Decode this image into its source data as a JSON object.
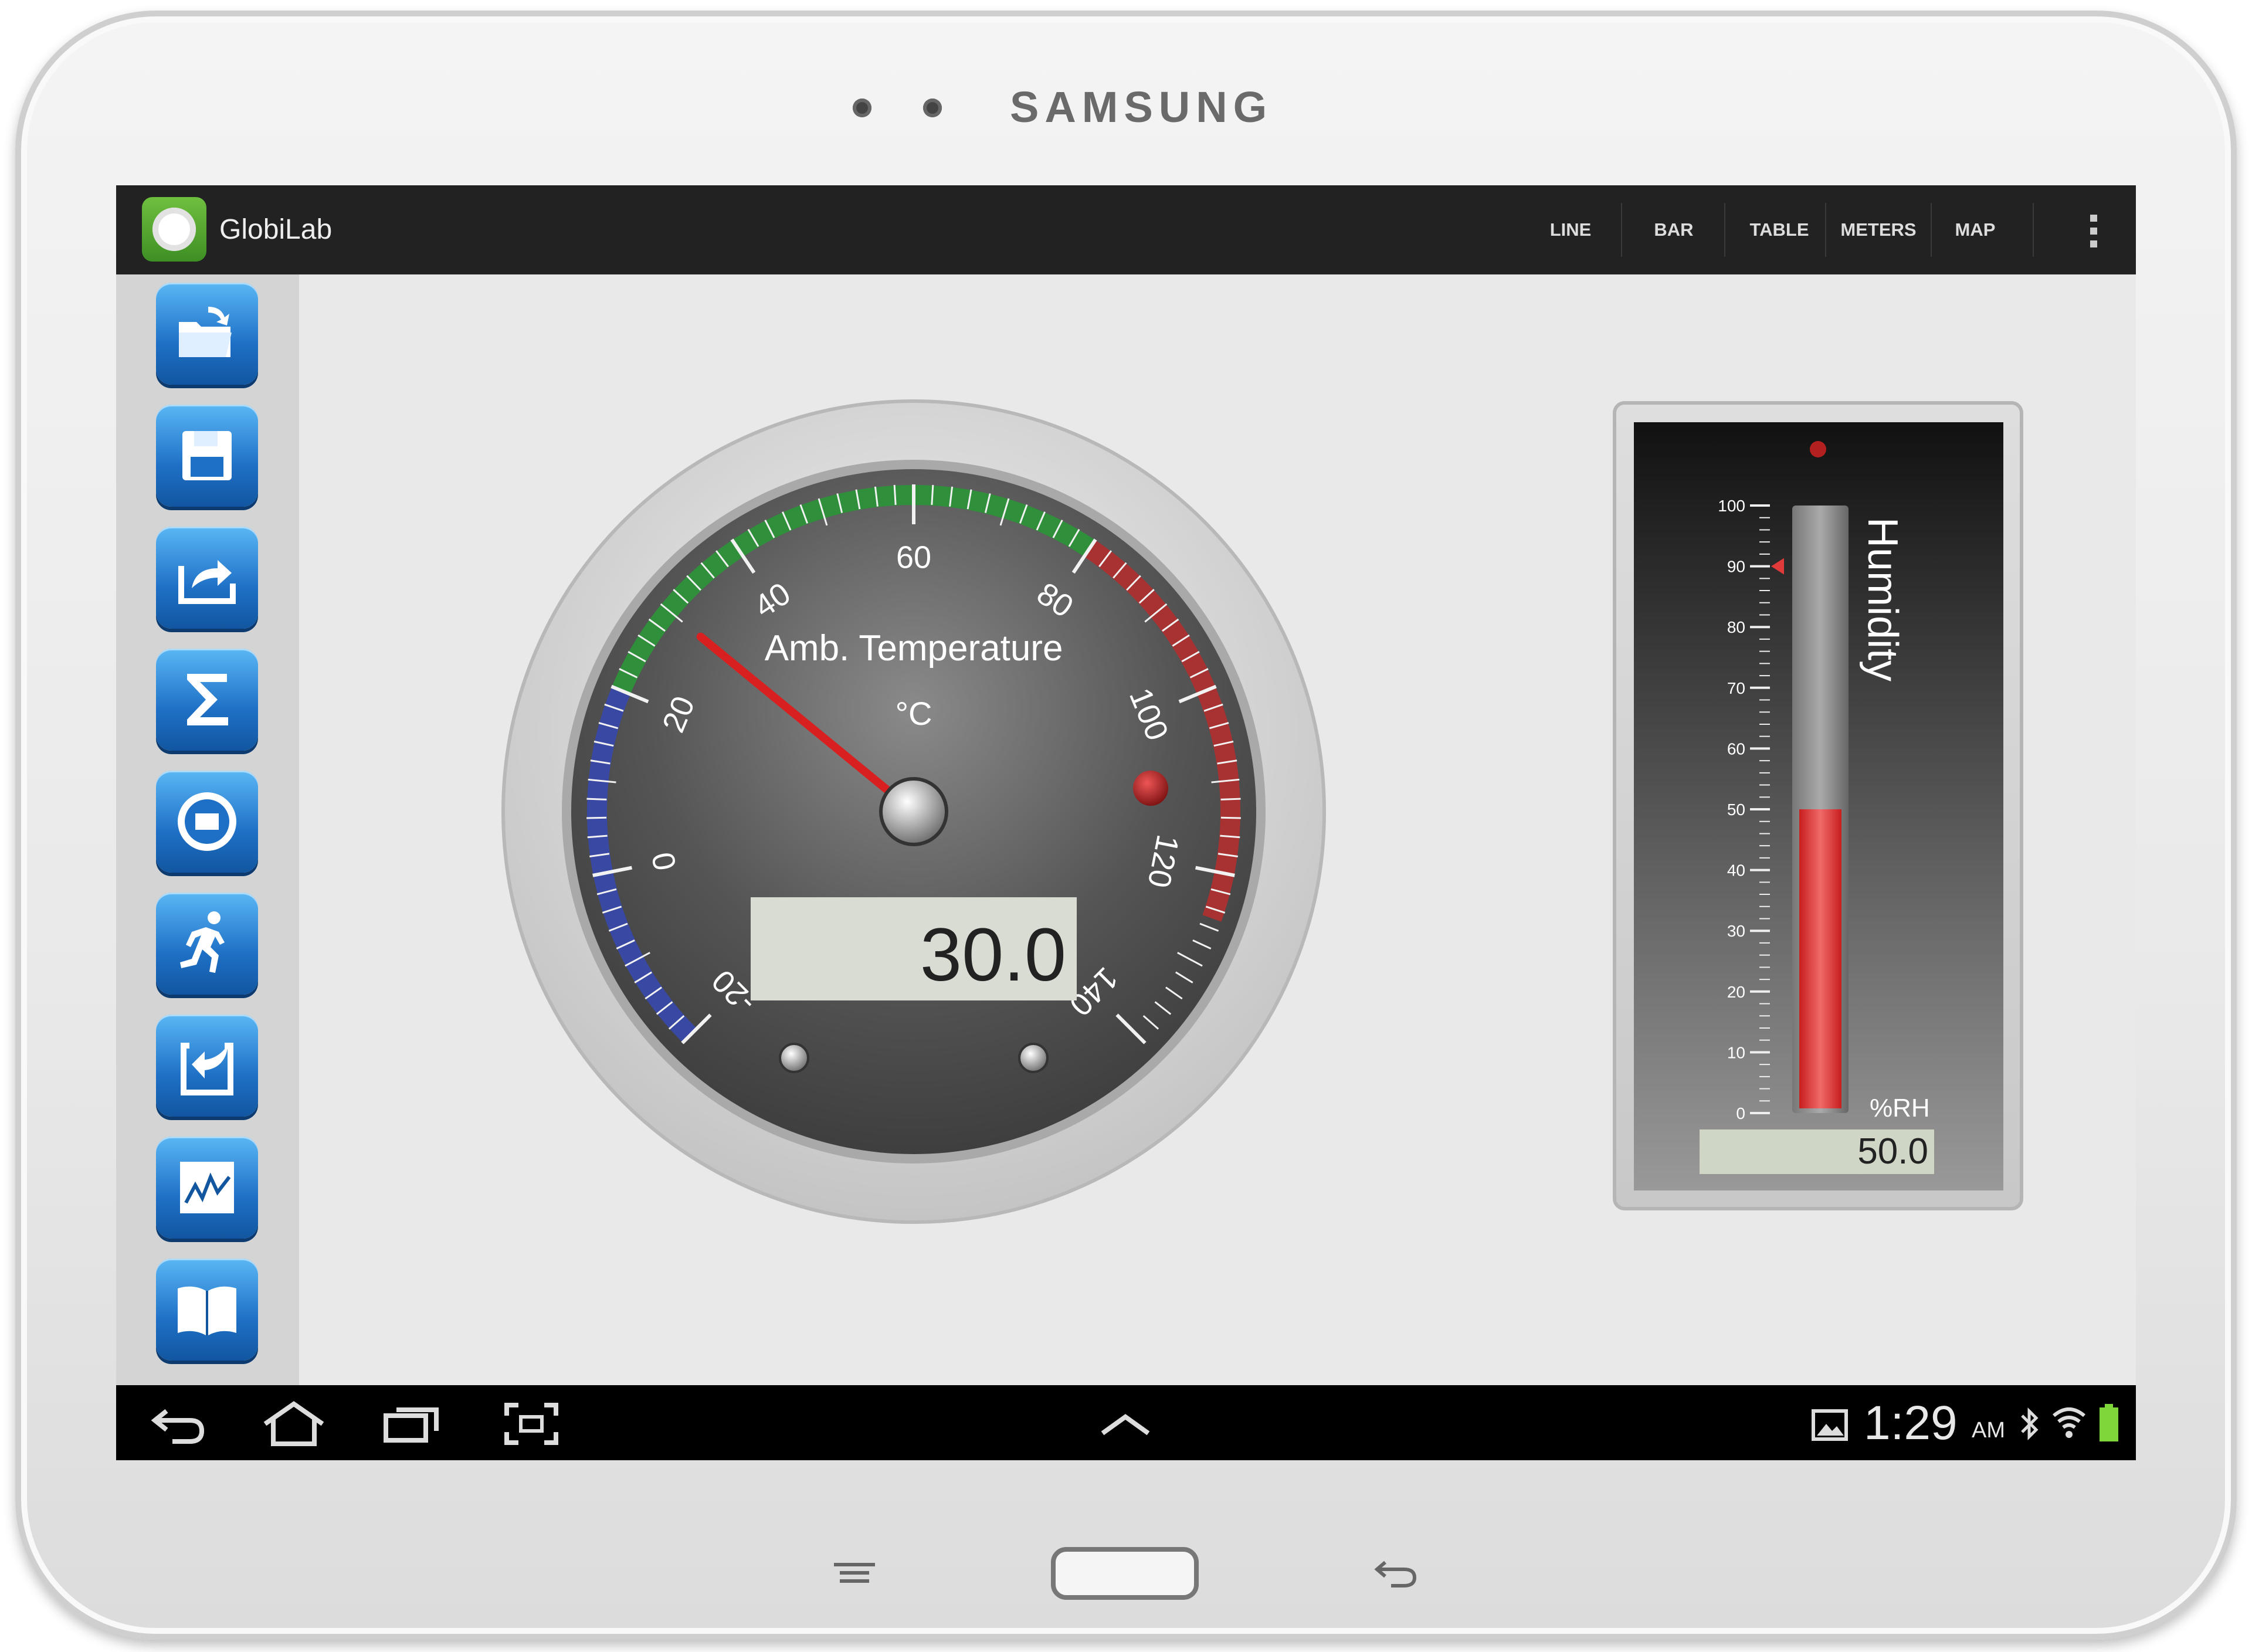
{
  "device": {
    "brand": "SAMSUNG"
  },
  "app": {
    "title": "GlobiLab"
  },
  "action_bar": {
    "menu": [
      "LINE",
      "BAR",
      "TABLE",
      "METERS",
      "MAP"
    ]
  },
  "sidebar": {
    "tools": [
      "open-folder-icon",
      "save-icon",
      "export-icon",
      "sigma-icon",
      "labdisc-icon",
      "running-man-icon",
      "import-icon",
      "graph-icon",
      "book-icon"
    ]
  },
  "temperature_gauge": {
    "title": "Amb. Temperature",
    "unit": "°C",
    "value": "30.0",
    "reading": 30.0,
    "scale_min": -20,
    "scale_max": 140,
    "tick_labels": [
      "-20",
      "0",
      "20",
      "40",
      "60",
      "80",
      "100",
      "120",
      "140"
    ],
    "colors": {
      "cold": "#3949a3",
      "normal": "#2f8f3a",
      "hot": "#a83232"
    }
  },
  "humidity_meter": {
    "title": "Humidity",
    "unit": "%RH",
    "value": "50.0",
    "fraction": 0.5,
    "tick_labels": [
      "100",
      "90",
      "80",
      "70",
      "60",
      "50",
      "40",
      "30",
      "20",
      "10",
      "0"
    ],
    "marker": 90,
    "bar_color": "#e03a3a"
  },
  "status_bar": {
    "time": "1:29",
    "ampm": "AM"
  }
}
